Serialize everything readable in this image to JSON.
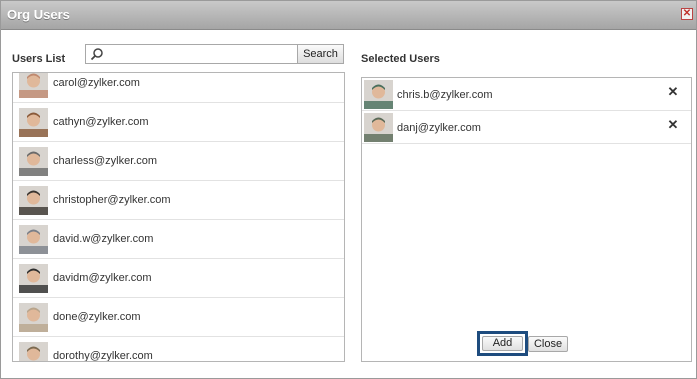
{
  "dialog": {
    "title": "Org Users",
    "close_glyph": "✕"
  },
  "users_list": {
    "label": "Users List",
    "search_placeholder": "",
    "search_button": "Search",
    "items": [
      {
        "email": "carol@zylker.com",
        "avatar": "avatar-photo",
        "tone": "#c08a70"
      },
      {
        "email": "cathyn@zylker.com",
        "avatar": "avatar-photo",
        "tone": "#8a5a3a"
      },
      {
        "email": "charless@zylker.com",
        "avatar": "avatar-photo",
        "tone": "#6b6b6b"
      },
      {
        "email": "christopher@zylker.com",
        "avatar": "avatar-photo",
        "tone": "#3a3530"
      },
      {
        "email": "david.w@zylker.com",
        "avatar": "avatar-photo",
        "tone": "#7a7f88"
      },
      {
        "email": "davidm@zylker.com",
        "avatar": "avatar-photo",
        "tone": "#2e2e2e"
      },
      {
        "email": "done@zylker.com",
        "avatar": "avatar-photo",
        "tone": "#b9a58c"
      },
      {
        "email": "dorothy@zylker.com",
        "avatar": "avatar-photo",
        "tone": "#7c6a50"
      }
    ]
  },
  "selected_users": {
    "label": "Selected Users",
    "remove_glyph": "✕",
    "items": [
      {
        "email": "chris.b@zylker.com",
        "avatar": "avatar-photo",
        "tone": "#4a6f5c"
      },
      {
        "email": "danj@zylker.com",
        "avatar": "avatar-photo",
        "tone": "#5a6a58"
      }
    ]
  },
  "actions": {
    "add": "Add",
    "close": "Close"
  },
  "colors": {
    "add_focus_border": "#1e4c7e",
    "titlebar": "#b4b4b4"
  }
}
